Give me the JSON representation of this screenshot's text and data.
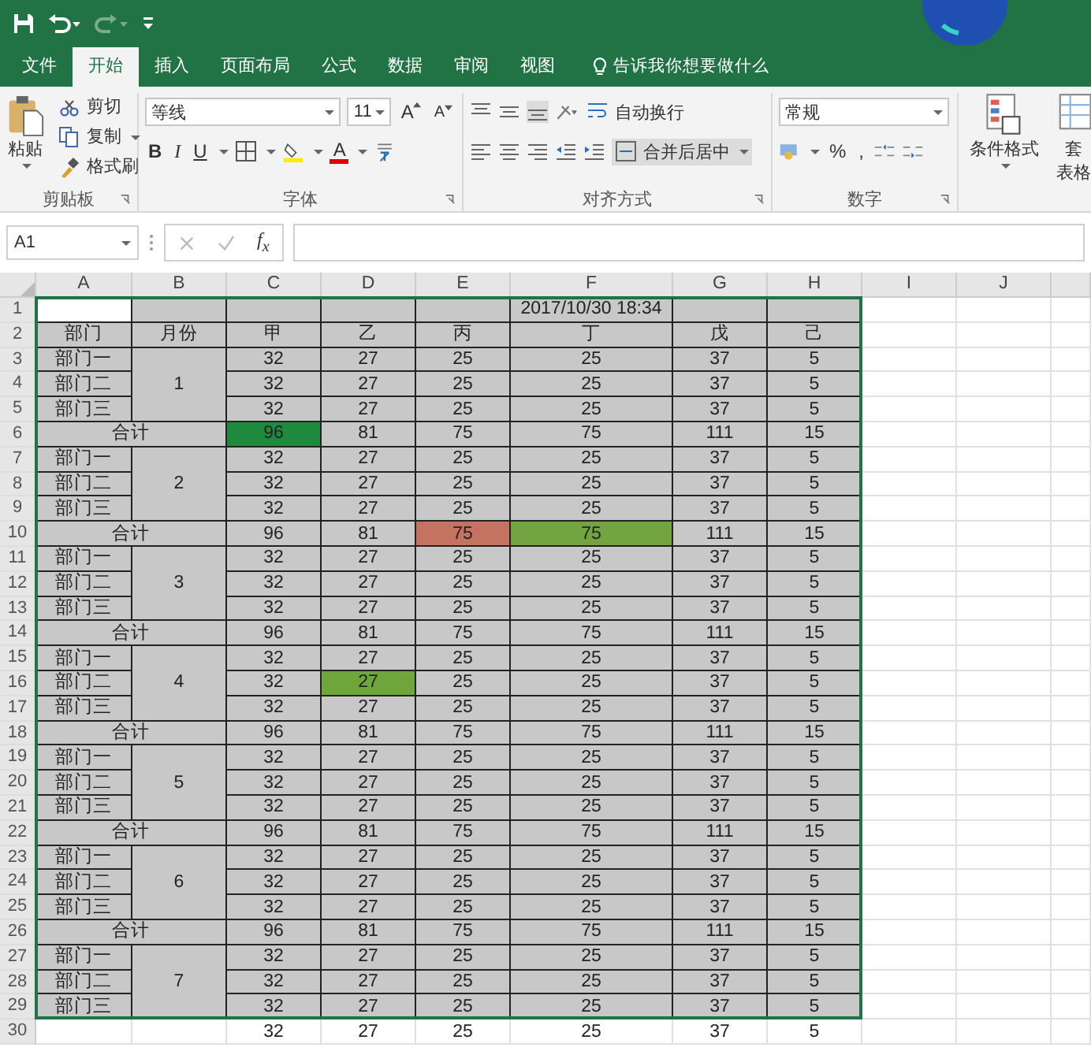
{
  "quick_access": [
    {
      "kind": "save",
      "disabled": false
    },
    {
      "kind": "undo",
      "disabled": false
    },
    {
      "kind": "redo",
      "disabled": true
    },
    {
      "kind": "customize",
      "disabled": false
    }
  ],
  "tabs": [
    {
      "label": "文件",
      "selected": false
    },
    {
      "label": "开始",
      "selected": true
    },
    {
      "label": "插入",
      "selected": false
    },
    {
      "label": "页面布局",
      "selected": false
    },
    {
      "label": "公式",
      "selected": false
    },
    {
      "label": "数据",
      "selected": false
    },
    {
      "label": "审阅",
      "selected": false
    },
    {
      "label": "视图",
      "selected": false
    }
  ],
  "tell_me": "告诉我你想要做什么",
  "clipboard": {
    "label": "剪贴板",
    "paste": "粘贴",
    "cut": "剪切",
    "copy": "复制",
    "format_painter": "格式刷"
  },
  "font": {
    "label": "字体",
    "name": "等线",
    "size": "11",
    "grow": "A",
    "shrink": "A",
    "bold": "B",
    "italic": "I",
    "underline": "U",
    "font_color": "A"
  },
  "alignment": {
    "label": "对齐方式",
    "wrap_text": "自动换行",
    "merge_center": "合并后居中"
  },
  "number": {
    "label": "数字",
    "format": "常规",
    "percent": "%",
    "comma": ","
  },
  "styles": {
    "conditional_formatting": "条件格式",
    "table_format_line1": "套",
    "table_format_line2": "表格"
  },
  "formula_bar": {
    "name_box": "A1",
    "function_label": "f$_{x}$"
  },
  "sheet": {
    "columns": [
      "A",
      "B",
      "C",
      "D",
      "E",
      "F",
      "G",
      "H",
      "I",
      "J"
    ],
    "row_numbers": [
      "1",
      "2",
      "3",
      "4",
      "5",
      "6",
      "7",
      "8",
      "9",
      "10",
      "11",
      "12",
      "13",
      "14",
      "15",
      "16",
      "17",
      "18",
      "19",
      "20",
      "21",
      "22",
      "23",
      "24",
      "25",
      "26",
      "27",
      "28",
      "29",
      "30"
    ],
    "date": "2017/10/30 18:34",
    "headers": [
      "部门",
      "月份",
      "甲",
      "乙",
      "丙",
      "丁",
      "戊",
      "己"
    ],
    "sections": [
      {
        "month": "1",
        "rows": [
          {
            "dept": "部门一",
            "values": [
              "32",
              "27",
              "25",
              "25",
              "37",
              "5"
            ]
          },
          {
            "dept": "部门二",
            "values": [
              "32",
              "27",
              "25",
              "25",
              "37",
              "5"
            ]
          },
          {
            "dept": "部门三",
            "values": [
              "32",
              "27",
              "25",
              "25",
              "37",
              "5"
            ]
          }
        ],
        "total": {
          "label": "合计",
          "values": [
            {
              "text": "96",
              "color": "#1f8a3e"
            },
            "81",
            "75",
            "75",
            "111",
            "15"
          ]
        }
      },
      {
        "month": "2",
        "rows": [
          {
            "dept": "部门一",
            "values": [
              "32",
              "27",
              "25",
              "25",
              "37",
              "5"
            ]
          },
          {
            "dept": "部门二",
            "values": [
              "32",
              "27",
              "25",
              "25",
              "37",
              "5"
            ]
          },
          {
            "dept": "部门三",
            "values": [
              "32",
              "27",
              "25",
              "25",
              "37",
              "5"
            ]
          }
        ],
        "total": {
          "label": "合计",
          "values": [
            "96",
            "81",
            {
              "text": "75",
              "color": "#c47262"
            },
            {
              "text": "75",
              "color": "#72a442"
            },
            "111",
            "15"
          ]
        }
      },
      {
        "month": "3",
        "rows": [
          {
            "dept": "部门一",
            "values": [
              "32",
              "27",
              "25",
              "25",
              "37",
              "5"
            ]
          },
          {
            "dept": "部门二",
            "values": [
              "32",
              "27",
              "25",
              "25",
              "37",
              "5"
            ]
          },
          {
            "dept": "部门三",
            "values": [
              "32",
              "27",
              "25",
              "25",
              "37",
              "5"
            ]
          }
        ],
        "total": {
          "label": "合计",
          "values": [
            "96",
            "81",
            "75",
            "75",
            "111",
            "15"
          ]
        }
      },
      {
        "month": "4",
        "rows": [
          {
            "dept": "部门一",
            "values": [
              "32",
              "27",
              "25",
              "25",
              "37",
              "5"
            ]
          },
          {
            "dept": "部门二",
            "values": [
              "32",
              {
                "text": "27",
                "color": "#6fa63c"
              },
              "25",
              "25",
              "37",
              "5"
            ]
          },
          {
            "dept": "部门三",
            "values": [
              "32",
              "27",
              "25",
              "25",
              "37",
              "5"
            ]
          }
        ],
        "total": {
          "label": "合计",
          "values": [
            "96",
            "81",
            "75",
            "75",
            "111",
            "15"
          ]
        }
      },
      {
        "month": "5",
        "rows": [
          {
            "dept": "部门一",
            "values": [
              "32",
              "27",
              "25",
              "25",
              "37",
              "5"
            ]
          },
          {
            "dept": "部门二",
            "values": [
              "32",
              "27",
              "25",
              "25",
              "37",
              "5"
            ]
          },
          {
            "dept": "部门三",
            "values": [
              "32",
              "27",
              "25",
              "25",
              "37",
              "5"
            ]
          }
        ],
        "total": {
          "label": "合计",
          "values": [
            "96",
            "81",
            "75",
            "75",
            "111",
            "15"
          ]
        }
      },
      {
        "month": "6",
        "rows": [
          {
            "dept": "部门一",
            "values": [
              "32",
              "27",
              "25",
              "25",
              "37",
              "5"
            ]
          },
          {
            "dept": "部门二",
            "values": [
              "32",
              "27",
              "25",
              "25",
              "37",
              "5"
            ]
          },
          {
            "dept": "部门三",
            "values": [
              "32",
              "27",
              "25",
              "25",
              "37",
              "5"
            ]
          }
        ],
        "total": {
          "label": "合计",
          "values": [
            "96",
            "81",
            "75",
            "75",
            "111",
            "15"
          ]
        }
      },
      {
        "month": "7",
        "rows": [
          {
            "dept": "部门一",
            "values": [
              "32",
              "27",
              "25",
              "25",
              "37",
              "5"
            ]
          },
          {
            "dept": "部门二",
            "values": [
              "32",
              "27",
              "25",
              "25",
              "37",
              "5"
            ]
          },
          {
            "dept": "部门三",
            "values": [
              "32",
              "27",
              "25",
              "25",
              "37",
              "5"
            ]
          }
        ]
      }
    ],
    "last_row": {
      "values": [
        "32",
        "27",
        "25",
        "25",
        "37",
        "5"
      ]
    }
  }
}
